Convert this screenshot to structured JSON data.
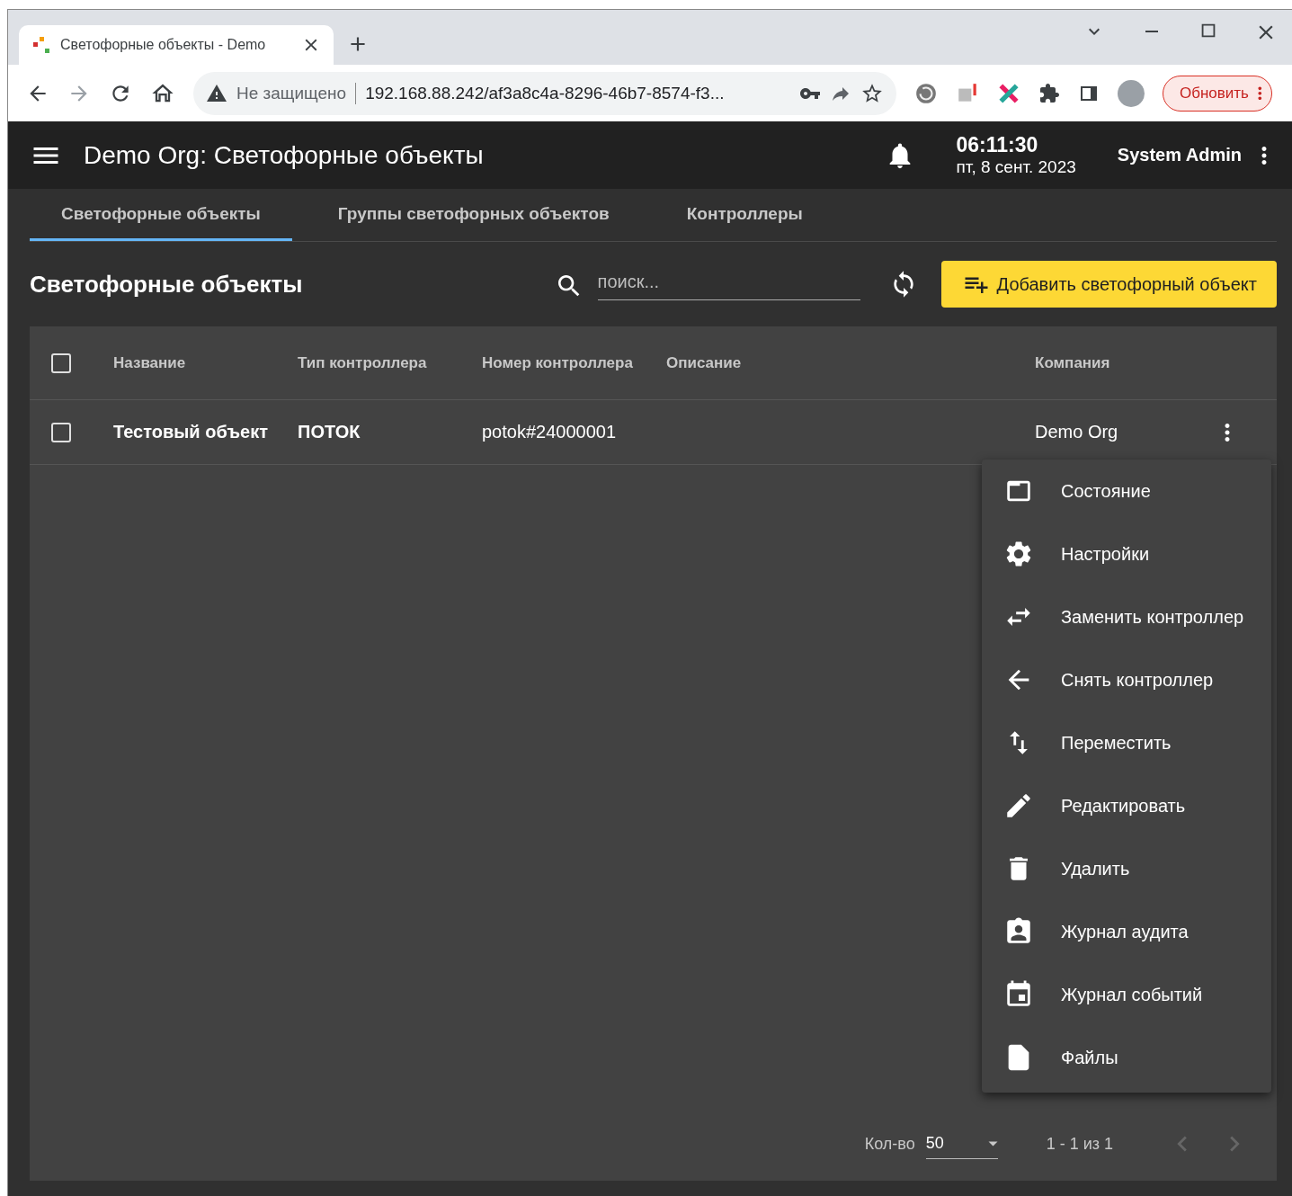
{
  "browser": {
    "tab_title": "Светофорные объекты - Demo",
    "security": "Не защищено",
    "url": "192.168.88.242/af3a8c4a-8296-46b7-8574-f3...",
    "update_button": "Обновить"
  },
  "header": {
    "title": "Demo Org: Светофорные объекты",
    "time": "06:11:30",
    "date": "пт, 8 сент. 2023",
    "user": "System Admin"
  },
  "tabs": [
    {
      "label": "Светофорные объекты",
      "selected": true
    },
    {
      "label": "Группы светофорных объектов",
      "selected": false
    },
    {
      "label": "Контроллеры",
      "selected": false
    }
  ],
  "toolbar": {
    "title": "Светофорные объекты",
    "search": {
      "placeholder": "поиск..."
    },
    "add_button": "Добавить светофорный объект"
  },
  "table": {
    "all_checked": false,
    "columns": [
      "Название",
      "Тип контроллера",
      "Номер контроллера",
      "Описание",
      "Компания"
    ],
    "rows": [
      {
        "checked": false,
        "cells": [
          "Тестовый объект",
          "ПОТОК",
          "potok#24000001",
          "",
          "Demo Org"
        ]
      }
    ]
  },
  "menu": [
    {
      "kind": "state",
      "label": "Состояние"
    },
    {
      "kind": "settings",
      "label": "Настройки"
    },
    {
      "kind": "replace",
      "label": "Заменить контроллер"
    },
    {
      "kind": "remove",
      "label": "Снять контроллер"
    },
    {
      "kind": "move",
      "label": "Переместить"
    },
    {
      "kind": "edit",
      "label": "Редактировать"
    },
    {
      "kind": "delete",
      "label": "Удалить"
    },
    {
      "kind": "audit",
      "label": "Журнал аудита"
    },
    {
      "kind": "events",
      "label": "Журнал событий"
    },
    {
      "kind": "files",
      "label": "Файлы"
    }
  ],
  "pagination": {
    "label": "Кол-во",
    "page_size": "50",
    "range": "1 - 1 из 1"
  }
}
